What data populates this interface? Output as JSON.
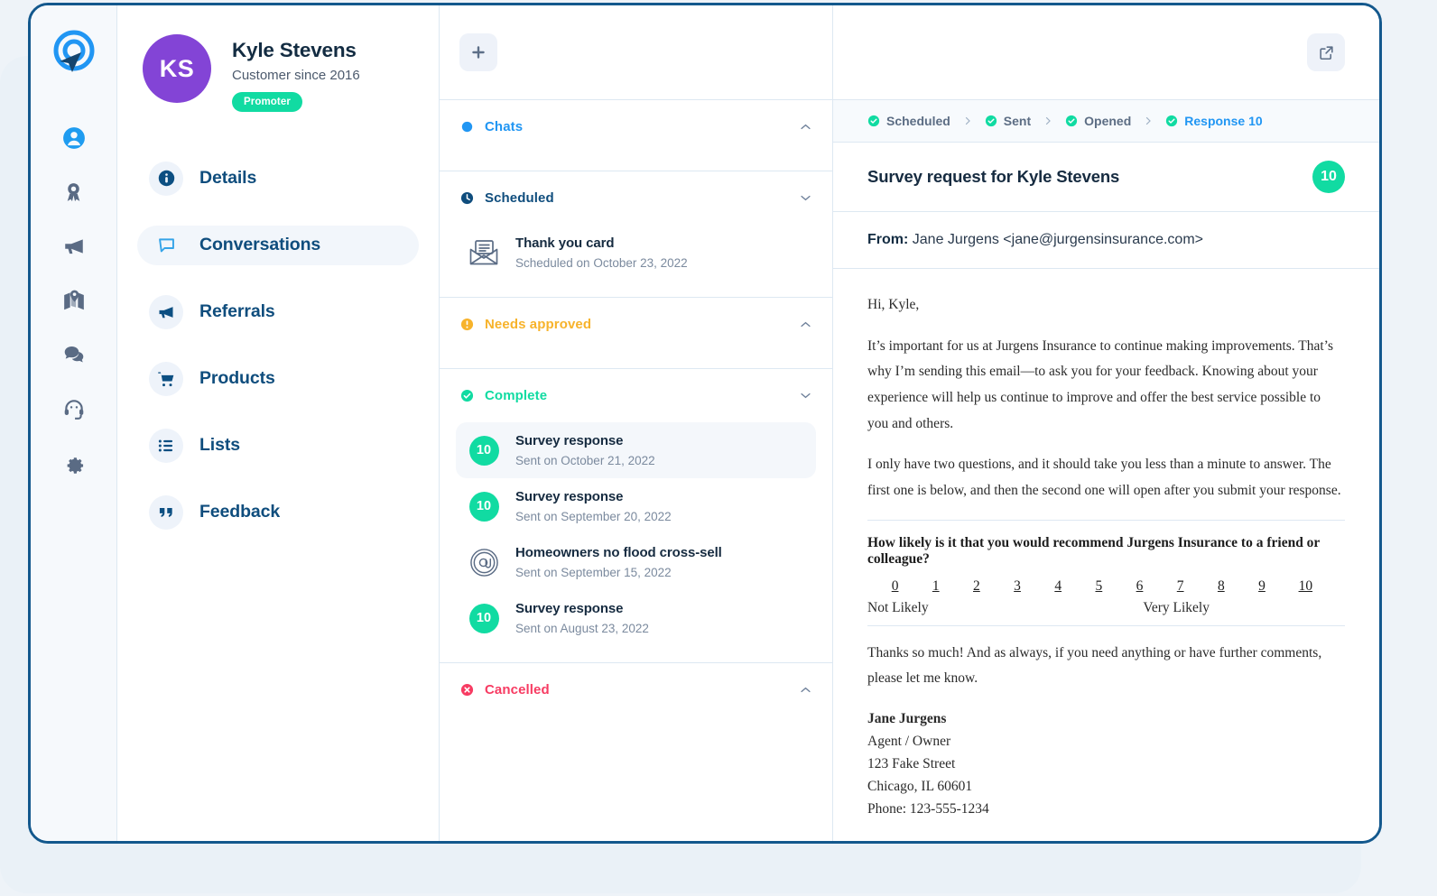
{
  "brand": {
    "logo_icon": "paper-plane-target-logo",
    "accent": "#2196f3",
    "frame_border": "#13588d"
  },
  "rail": {
    "items": [
      {
        "icon": "user-circle-icon",
        "name": "contacts",
        "active": true
      },
      {
        "icon": "award-ribbon-icon",
        "name": "rewards",
        "active": false
      },
      {
        "icon": "megaphone-icon",
        "name": "campaigns",
        "active": false
      },
      {
        "icon": "map-pin-icon",
        "name": "map",
        "active": false
      },
      {
        "icon": "chat-bubbles-icon",
        "name": "messages",
        "active": false
      },
      {
        "icon": "headset-icon",
        "name": "support",
        "active": false
      },
      {
        "icon": "gear-icon",
        "name": "settings",
        "active": false
      }
    ]
  },
  "profile": {
    "initials": "KS",
    "name": "Kyle Stevens",
    "subtitle": "Customer since 2016",
    "badge": "Promoter",
    "badge_color": "#11dba2",
    "avatar_color": "#8344d6"
  },
  "nav": {
    "items": [
      {
        "label": "Details",
        "icon": "info-icon",
        "active": false
      },
      {
        "label": "Conversations",
        "icon": "chat-square-icon",
        "active": true
      },
      {
        "label": "Referrals",
        "icon": "megaphone-icon",
        "active": false
      },
      {
        "label": "Products",
        "icon": "shopping-cart-icon",
        "active": false
      },
      {
        "label": "Lists",
        "icon": "list-icon",
        "active": false
      },
      {
        "label": "Feedback",
        "icon": "quote-icon",
        "active": false
      }
    ]
  },
  "middle": {
    "add_button_label": "+",
    "sections": [
      {
        "title": "Chats",
        "icon": "filled-circle-icon",
        "color": "#2196f3",
        "chevron": "up",
        "items": []
      },
      {
        "title": "Scheduled",
        "icon": "clock-icon",
        "color": "#0f4d7d",
        "chevron": "down",
        "items": [
          {
            "icon": "open-envelope-icon",
            "title": "Thank you card",
            "subtitle": "Scheduled on October 23, 2022",
            "selected": false
          }
        ]
      },
      {
        "title": "Needs approved",
        "icon": "alert-circle-icon",
        "color": "#f7b32b",
        "chevron": "up",
        "items": []
      },
      {
        "title": "Complete",
        "icon": "check-circle-icon",
        "color": "#11dba2",
        "chevron": "down",
        "items": [
          {
            "icon": "score-bubble",
            "score": "10",
            "title": "Survey response",
            "subtitle": "Sent on October 21,  2022",
            "selected": true
          },
          {
            "icon": "score-bubble",
            "score": "10",
            "title": "Survey response",
            "subtitle": "Sent on September 20,  2022",
            "selected": false
          },
          {
            "icon": "at-fingerprint-icon",
            "score": "",
            "title": "Homeowners no flood cross-sell",
            "subtitle": "Sent on September 15, 2022",
            "selected": false
          },
          {
            "icon": "score-bubble",
            "score": "10",
            "title": "Survey response",
            "subtitle": "Sent on August 23,  2022",
            "selected": false
          }
        ]
      },
      {
        "title": "Cancelled",
        "icon": "x-circle-icon",
        "color": "#f73b62",
        "chevron": "up",
        "items": []
      }
    ]
  },
  "right": {
    "open_external_icon": "open-external-icon",
    "breadcrumb": [
      {
        "label": "Scheduled",
        "current": false
      },
      {
        "label": "Sent",
        "current": false
      },
      {
        "label": "Opened",
        "current": false
      },
      {
        "label": "Response 10",
        "current": true
      }
    ],
    "subject": "Survey request for Kyle Stevens",
    "score_badge": "10",
    "from_label": "From:",
    "from_value": "Jane Jurgens <jane@jurgensinsurance.com>",
    "email": {
      "greeting": "Hi, Kyle,",
      "paragraph_1": "It’s important for us at Jurgens Insurance to continue making improvements. That’s why I’m sending this email—to ask you for your feedback. Knowing about your experience will help us continue to improve and offer the best service possible to you and others.",
      "paragraph_2": "I only have two questions, and it should take you less than a minute to answer. The first one is below, and then the second one will open after you submit your response.",
      "nps_question": "How likely is it that you would recommend Jurgens Insurance to a friend or colleague?",
      "nps_scale": [
        "0",
        "1",
        "2",
        "3",
        "4",
        "5",
        "6",
        "7",
        "8",
        "9",
        "10"
      ],
      "nps_low_label": "Not Likely",
      "nps_high_label": "Very Likely",
      "closing": "Thanks so much! And as always, if you need anything or have further comments, please let me know.",
      "signature": {
        "name": "Jane Jurgens",
        "title": "Agent / Owner",
        "street": "123 Fake Street",
        "city": "Chicago, IL 60601",
        "phone": "Phone: 123-555-1234"
      }
    }
  }
}
